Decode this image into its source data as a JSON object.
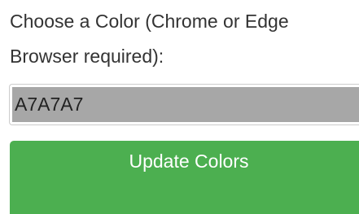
{
  "form": {
    "label": "Choose a Color (Chrome or Edge Browser required):",
    "color_value": "A7A7A7",
    "color_hex": "#A7A7A7",
    "button_label": "Update Colors",
    "button_color": "#4CAF50"
  }
}
